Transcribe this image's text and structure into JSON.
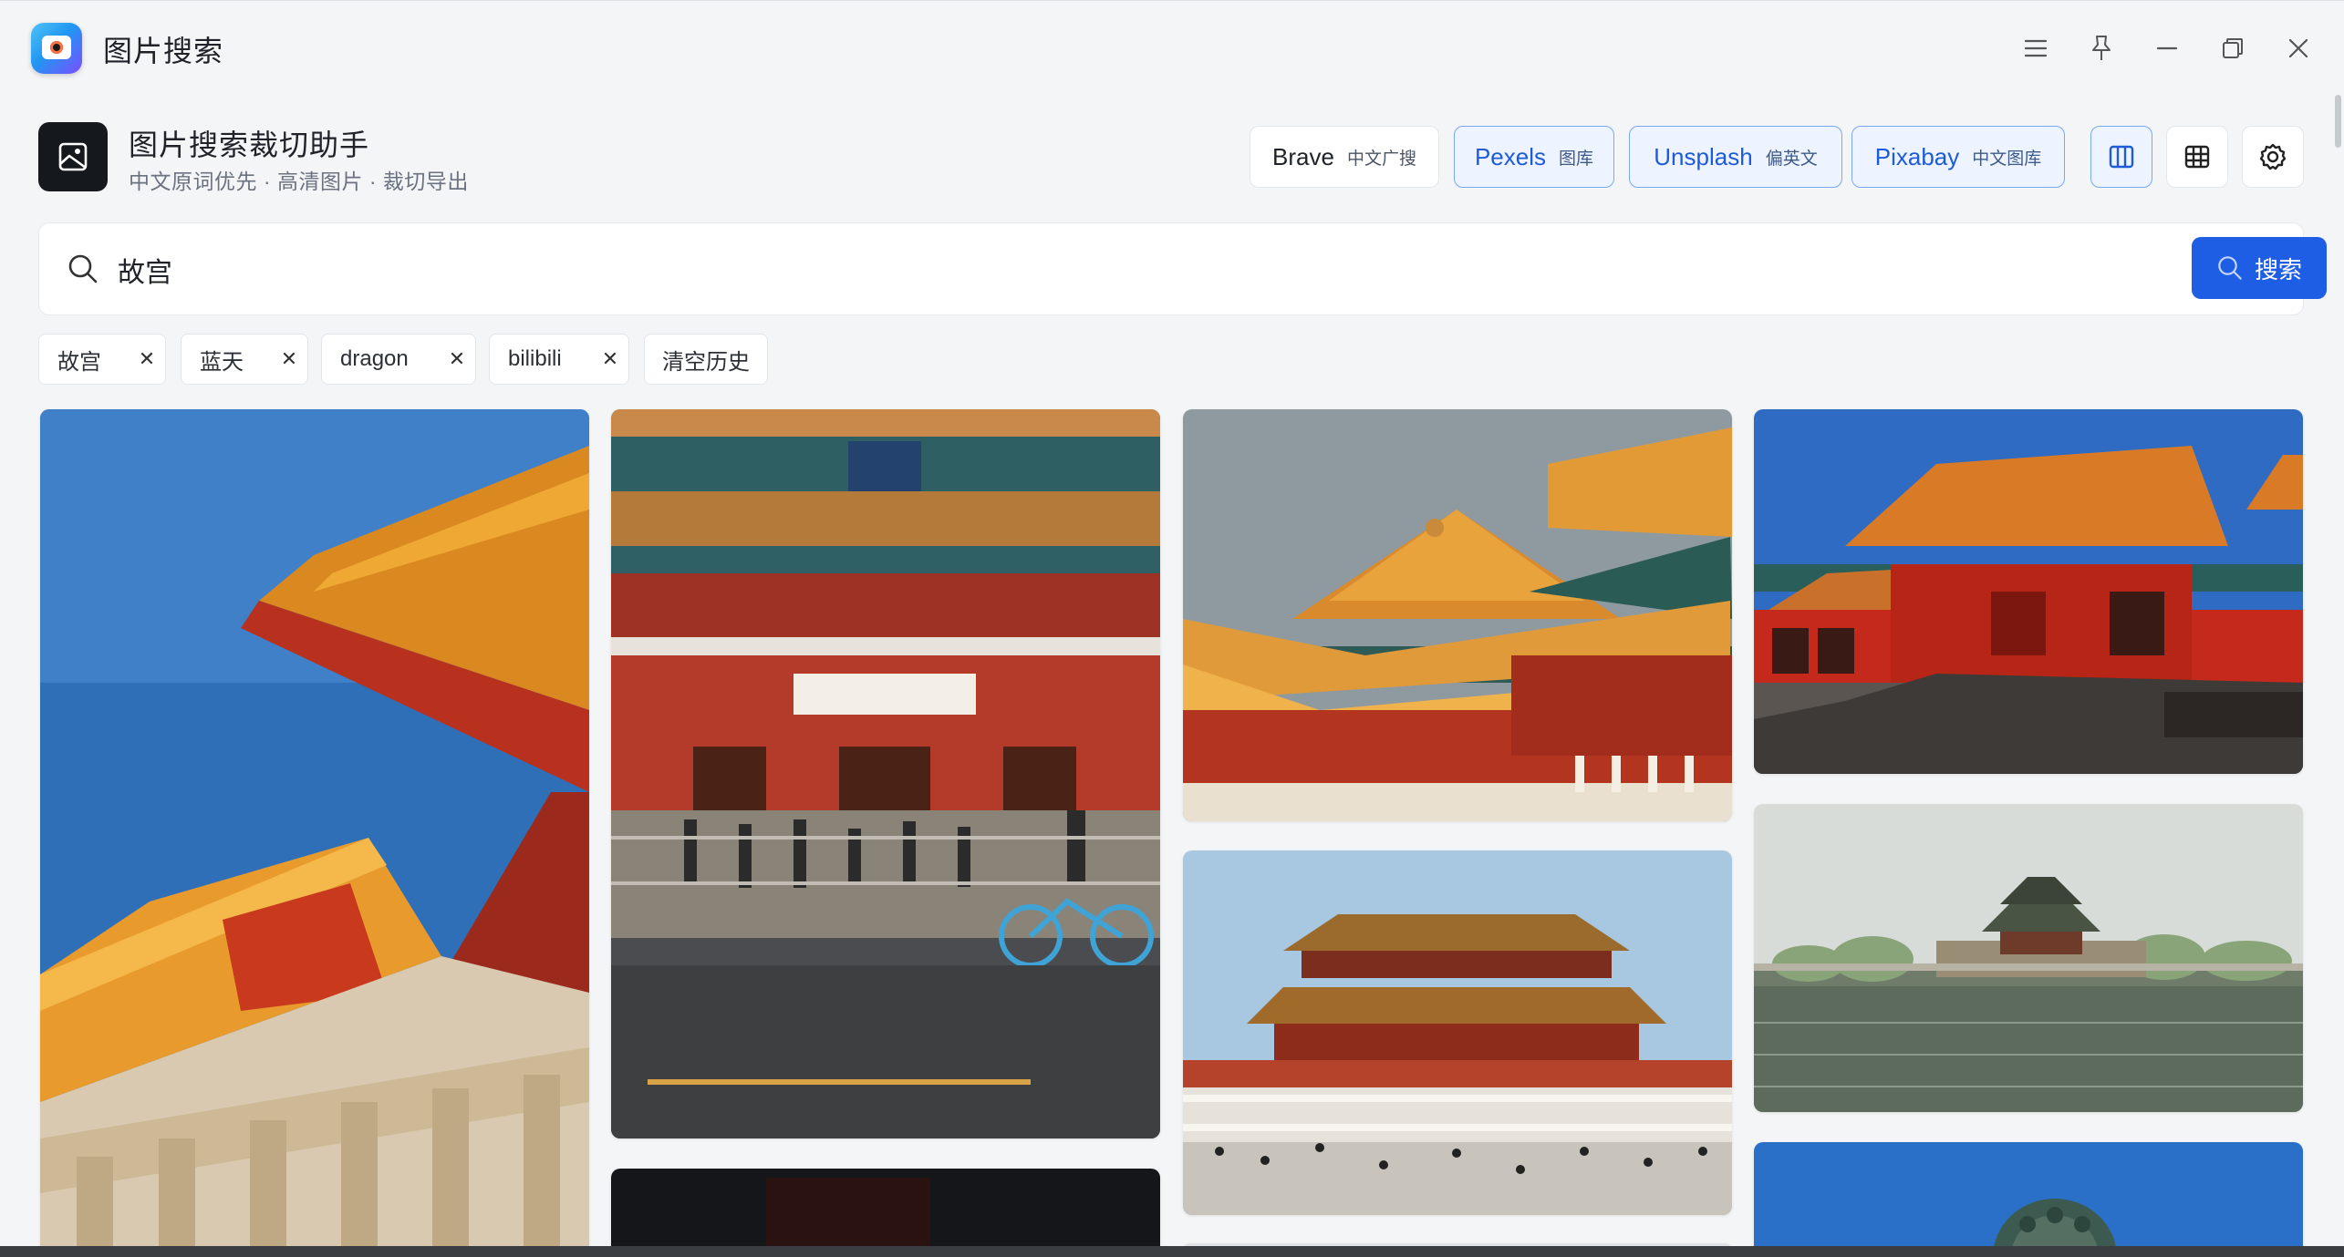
{
  "window": {
    "title": "图片搜索"
  },
  "header": {
    "title": "图片搜索裁切助手",
    "subtitle": "中文原词优先 · 高清图片 · 裁切导出",
    "sources": [
      {
        "name": "Brave",
        "tag": "中文广搜",
        "active": false
      },
      {
        "name": "Pexels",
        "tag": "图库",
        "active": true
      },
      {
        "name": "Unsplash",
        "tag": "偏英文",
        "active": true
      },
      {
        "name": "Pixabay",
        "tag": "中文图库",
        "active": true
      }
    ],
    "view_mode": "columns"
  },
  "search": {
    "query": "故宫",
    "button_label": "搜索"
  },
  "history": {
    "items": [
      "故宫",
      "蓝天",
      "dragon",
      "bilibili"
    ],
    "clear_label": "清空历史"
  },
  "gallery": {
    "columns": 4,
    "images": [
      {
        "subject": "Forbidden City golden roof eaves against blue sky"
      },
      {
        "subject": "Palace Museum gate with crowd and bicycle"
      },
      {
        "subject": "Layered golden rooftops of palace halls"
      },
      {
        "subject": "Red palace hall in evening sunlight"
      },
      {
        "subject": "Hall of Supreme Harmony with crowds"
      },
      {
        "subject": "Corner tower over the moat"
      },
      {
        "subject": "Dark palace interior"
      },
      {
        "subject": "Bronze lion under blue sky"
      }
    ]
  },
  "colors": {
    "accent": "#1e5ee5",
    "active_border": "#7aa7f5",
    "active_bg": "#eef4ff",
    "background": "#f4f5f7"
  }
}
